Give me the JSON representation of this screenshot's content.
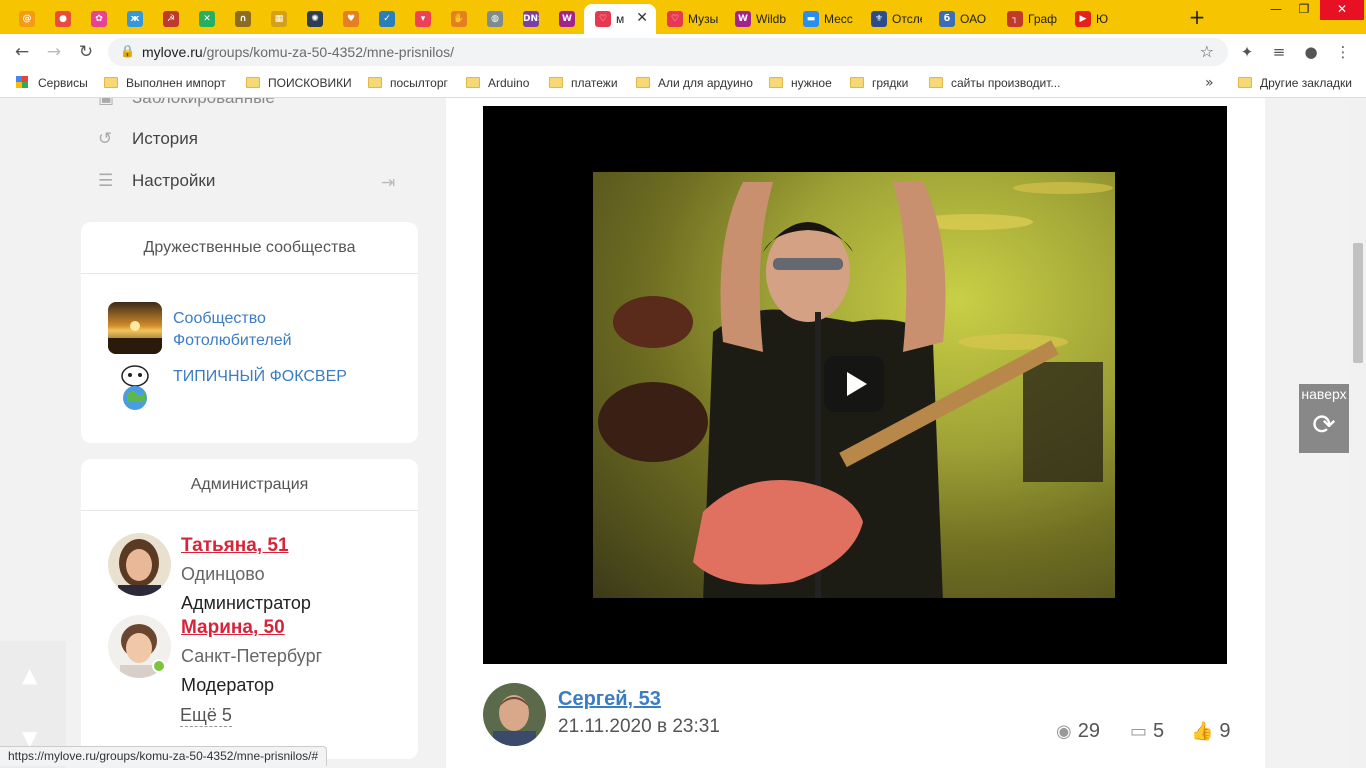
{
  "browser": {
    "tabs": [
      {
        "title": "",
        "icon": "mail-ru-icon",
        "color": "#f39c12"
      },
      {
        "title": "",
        "icon": "chat-bubble-icon",
        "color": "#e74c3c"
      },
      {
        "title": "",
        "icon": "flower-icon",
        "color": "#e84393"
      },
      {
        "title": "",
        "icon": "butterfly-icon",
        "color": "#3498db"
      },
      {
        "title": "",
        "icon": "emblem-icon",
        "color": "#c0392b"
      },
      {
        "title": "",
        "icon": "tools-icon",
        "color": "#27ae60"
      },
      {
        "title": "",
        "icon": "lock-icon",
        "color": "#8e6b1e"
      },
      {
        "title": "",
        "icon": "grid-icon",
        "color": "#d4a017"
      },
      {
        "title": "",
        "icon": "gear-icon",
        "color": "#2c3e50"
      },
      {
        "title": "",
        "icon": "heart-flag-icon",
        "color": "#e67e22"
      },
      {
        "title": "",
        "icon": "check-circle-icon",
        "color": "#2980b9"
      },
      {
        "title": "",
        "icon": "pocket-icon",
        "color": "#ee4056"
      },
      {
        "title": "",
        "icon": "hand-icon",
        "color": "#e67e22"
      },
      {
        "title": "",
        "icon": "globe-icon",
        "color": "#7f8c8d"
      },
      {
        "title": "",
        "icon": "dns-icon",
        "color": "#7b3fa0"
      },
      {
        "title": "",
        "icon": "wildberries-icon",
        "color": "#a3238e"
      },
      {
        "title": "м",
        "icon": "heart-icon",
        "color": "#e63950",
        "active": true
      },
      {
        "title": "Музы",
        "icon": "heart-icon",
        "color": "#e63950"
      },
      {
        "title": "Wildb",
        "icon": "wildberries-icon",
        "color": "#a3238e"
      },
      {
        "title": "Месс",
        "icon": "message-icon",
        "color": "#2a8ef0"
      },
      {
        "title": "Отсле",
        "icon": "eagle-icon",
        "color": "#2c4d8a"
      },
      {
        "title": "ОАО",
        "icon": "b-icon",
        "color": "#3a6fb5"
      },
      {
        "title": "Граф",
        "icon": "chart-icon",
        "color": "#c0392b"
      },
      {
        "title": "Ю",
        "icon": "youtube-icon",
        "color": "#e62117"
      }
    ],
    "new_tab": "+",
    "window": {
      "minimize": "—",
      "maximize": "❐",
      "close": "✕"
    },
    "url_host": "mylove.ru",
    "url_path": "/groups/komu-za-50-4352/mne-prisnilos/",
    "bookmarks": [
      {
        "label": "Сервисы",
        "type": "apps"
      },
      {
        "label": "Выполнен импорт",
        "type": "folder"
      },
      {
        "label": "ПОИСКОВИКИ",
        "type": "folder"
      },
      {
        "label": "посылторг",
        "type": "folder"
      },
      {
        "label": "Arduino",
        "type": "folder"
      },
      {
        "label": "платежи",
        "type": "folder"
      },
      {
        "label": "Али для ардуино",
        "type": "folder"
      },
      {
        "label": "нужное",
        "type": "folder"
      },
      {
        "label": "грядки",
        "type": "folder"
      },
      {
        "label": "сайты производит...",
        "type": "folder"
      }
    ],
    "bookmarks_more": "»",
    "other_bookmarks": "Другие закладки",
    "status_url": "https://mylove.ru/groups/komu-za-50-4352/mne-prisnilos/#"
  },
  "sidebar": {
    "menu": [
      {
        "label": "Заблокированные",
        "icon": "lock-icon"
      },
      {
        "label": "История",
        "icon": "history-icon"
      },
      {
        "label": "Настройки",
        "icon": "sliders-icon"
      }
    ],
    "friendly": {
      "title": "Дружественные сообщества",
      "items": [
        {
          "name": "Сообщество Фотолюбителей",
          "line1": "Сообщество",
          "line2": "Фотолюбителей"
        },
        {
          "name": "ТИПИЧНЫЙ ФОКСВЕР",
          "line1": "ТИПИЧНЫЙ ФОКСВЕР",
          "line2": ""
        }
      ]
    },
    "admin": {
      "title": "Администрация",
      "members": [
        {
          "name": "Татьяна, 51",
          "city": "Одинцово",
          "role": "Администратор",
          "online": false
        },
        {
          "name": "Марина, 50",
          "city": "Санкт-Петербург",
          "role": "Модератор",
          "online": true
        }
      ],
      "more": "Ещё 5"
    }
  },
  "post": {
    "author": "Сергей, 53",
    "date": "21.11.2020 в 23:31",
    "views": "29",
    "comments": "5",
    "likes": "9"
  },
  "to_top": {
    "label": "наверх"
  },
  "colors": {
    "tabstrip": "#f6c400",
    "link": "#3b7dc4",
    "admin_name": "#d8233a",
    "online": "#7cc53a"
  }
}
